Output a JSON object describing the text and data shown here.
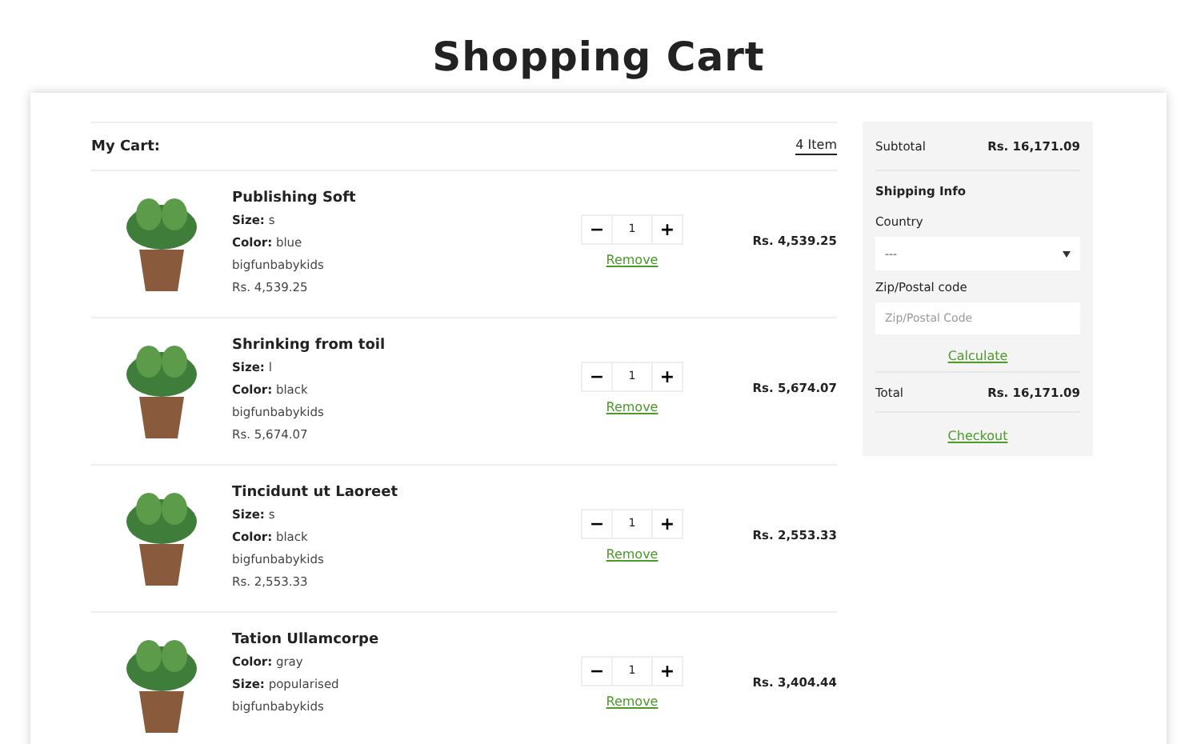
{
  "page_title": "Shopping Cart",
  "cart": {
    "heading": "My Cart:",
    "count": "4 Item",
    "items": [
      {
        "name": "Publishing Soft",
        "details": [
          {
            "label": "Size:",
            "value": "s"
          },
          {
            "label": "Color:",
            "value": "blue"
          }
        ],
        "brand": "bigfunbabykids",
        "unit_price": "Rs. 4,539.25",
        "quantity": "1",
        "minus": "−",
        "plus": "+",
        "remove": "Remove",
        "line_total": "Rs. 4,539.25"
      },
      {
        "name": "Shrinking from toil",
        "details": [
          {
            "label": "Size:",
            "value": "l"
          },
          {
            "label": "Color:",
            "value": "black"
          }
        ],
        "brand": "bigfunbabykids",
        "unit_price": "Rs. 5,674.07",
        "quantity": "1",
        "minus": "−",
        "plus": "+",
        "remove": "Remove",
        "line_total": "Rs. 5,674.07"
      },
      {
        "name": "Tincidunt ut Laoreet",
        "details": [
          {
            "label": "Size:",
            "value": "s"
          },
          {
            "label": "Color:",
            "value": "black"
          }
        ],
        "brand": "bigfunbabykids",
        "unit_price": "Rs. 2,553.33",
        "quantity": "1",
        "minus": "−",
        "plus": "+",
        "remove": "Remove",
        "line_total": "Rs. 2,553.33"
      },
      {
        "name": "Tation Ullamcorpe",
        "details": [
          {
            "label": "Color:",
            "value": "gray"
          },
          {
            "label": "Size:",
            "value": "popularised"
          }
        ],
        "brand": "bigfunbabykids",
        "quantity": "1",
        "minus": "−",
        "plus": "+",
        "remove": "Remove",
        "line_total": "Rs. 3,404.44"
      }
    ]
  },
  "summary": {
    "subtotal_label": "Subtotal",
    "subtotal": "Rs. 16,171.09",
    "shipping_heading": "Shipping Info",
    "country_label": "Country",
    "country_value": "---",
    "zip_label": "Zip/Postal code",
    "zip_placeholder": "Zip/Postal Code",
    "calculate": "Calculate",
    "total_label": "Total",
    "total": "Rs. 16,171.09",
    "checkout": "Checkout"
  }
}
